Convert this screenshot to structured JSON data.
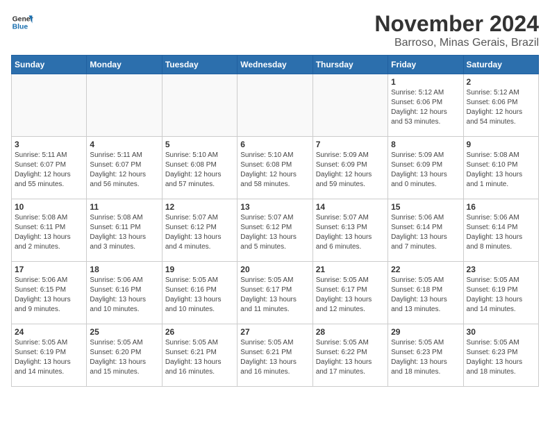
{
  "logo": {
    "general": "General",
    "blue": "Blue"
  },
  "title": "November 2024",
  "location": "Barroso, Minas Gerais, Brazil",
  "weekdays": [
    "Sunday",
    "Monday",
    "Tuesday",
    "Wednesday",
    "Thursday",
    "Friday",
    "Saturday"
  ],
  "weeks": [
    [
      {
        "day": "",
        "info": ""
      },
      {
        "day": "",
        "info": ""
      },
      {
        "day": "",
        "info": ""
      },
      {
        "day": "",
        "info": ""
      },
      {
        "day": "",
        "info": ""
      },
      {
        "day": "1",
        "info": "Sunrise: 5:12 AM\nSunset: 6:06 PM\nDaylight: 12 hours\nand 53 minutes."
      },
      {
        "day": "2",
        "info": "Sunrise: 5:12 AM\nSunset: 6:06 PM\nDaylight: 12 hours\nand 54 minutes."
      }
    ],
    [
      {
        "day": "3",
        "info": "Sunrise: 5:11 AM\nSunset: 6:07 PM\nDaylight: 12 hours\nand 55 minutes."
      },
      {
        "day": "4",
        "info": "Sunrise: 5:11 AM\nSunset: 6:07 PM\nDaylight: 12 hours\nand 56 minutes."
      },
      {
        "day": "5",
        "info": "Sunrise: 5:10 AM\nSunset: 6:08 PM\nDaylight: 12 hours\nand 57 minutes."
      },
      {
        "day": "6",
        "info": "Sunrise: 5:10 AM\nSunset: 6:08 PM\nDaylight: 12 hours\nand 58 minutes."
      },
      {
        "day": "7",
        "info": "Sunrise: 5:09 AM\nSunset: 6:09 PM\nDaylight: 12 hours\nand 59 minutes."
      },
      {
        "day": "8",
        "info": "Sunrise: 5:09 AM\nSunset: 6:09 PM\nDaylight: 13 hours\nand 0 minutes."
      },
      {
        "day": "9",
        "info": "Sunrise: 5:08 AM\nSunset: 6:10 PM\nDaylight: 13 hours\nand 1 minute."
      }
    ],
    [
      {
        "day": "10",
        "info": "Sunrise: 5:08 AM\nSunset: 6:11 PM\nDaylight: 13 hours\nand 2 minutes."
      },
      {
        "day": "11",
        "info": "Sunrise: 5:08 AM\nSunset: 6:11 PM\nDaylight: 13 hours\nand 3 minutes."
      },
      {
        "day": "12",
        "info": "Sunrise: 5:07 AM\nSunset: 6:12 PM\nDaylight: 13 hours\nand 4 minutes."
      },
      {
        "day": "13",
        "info": "Sunrise: 5:07 AM\nSunset: 6:12 PM\nDaylight: 13 hours\nand 5 minutes."
      },
      {
        "day": "14",
        "info": "Sunrise: 5:07 AM\nSunset: 6:13 PM\nDaylight: 13 hours\nand 6 minutes."
      },
      {
        "day": "15",
        "info": "Sunrise: 5:06 AM\nSunset: 6:14 PM\nDaylight: 13 hours\nand 7 minutes."
      },
      {
        "day": "16",
        "info": "Sunrise: 5:06 AM\nSunset: 6:14 PM\nDaylight: 13 hours\nand 8 minutes."
      }
    ],
    [
      {
        "day": "17",
        "info": "Sunrise: 5:06 AM\nSunset: 6:15 PM\nDaylight: 13 hours\nand 9 minutes."
      },
      {
        "day": "18",
        "info": "Sunrise: 5:06 AM\nSunset: 6:16 PM\nDaylight: 13 hours\nand 10 minutes."
      },
      {
        "day": "19",
        "info": "Sunrise: 5:05 AM\nSunset: 6:16 PM\nDaylight: 13 hours\nand 10 minutes."
      },
      {
        "day": "20",
        "info": "Sunrise: 5:05 AM\nSunset: 6:17 PM\nDaylight: 13 hours\nand 11 minutes."
      },
      {
        "day": "21",
        "info": "Sunrise: 5:05 AM\nSunset: 6:17 PM\nDaylight: 13 hours\nand 12 minutes."
      },
      {
        "day": "22",
        "info": "Sunrise: 5:05 AM\nSunset: 6:18 PM\nDaylight: 13 hours\nand 13 minutes."
      },
      {
        "day": "23",
        "info": "Sunrise: 5:05 AM\nSunset: 6:19 PM\nDaylight: 13 hours\nand 14 minutes."
      }
    ],
    [
      {
        "day": "24",
        "info": "Sunrise: 5:05 AM\nSunset: 6:19 PM\nDaylight: 13 hours\nand 14 minutes."
      },
      {
        "day": "25",
        "info": "Sunrise: 5:05 AM\nSunset: 6:20 PM\nDaylight: 13 hours\nand 15 minutes."
      },
      {
        "day": "26",
        "info": "Sunrise: 5:05 AM\nSunset: 6:21 PM\nDaylight: 13 hours\nand 16 minutes."
      },
      {
        "day": "27",
        "info": "Sunrise: 5:05 AM\nSunset: 6:21 PM\nDaylight: 13 hours\nand 16 minutes."
      },
      {
        "day": "28",
        "info": "Sunrise: 5:05 AM\nSunset: 6:22 PM\nDaylight: 13 hours\nand 17 minutes."
      },
      {
        "day": "29",
        "info": "Sunrise: 5:05 AM\nSunset: 6:23 PM\nDaylight: 13 hours\nand 18 minutes."
      },
      {
        "day": "30",
        "info": "Sunrise: 5:05 AM\nSunset: 6:23 PM\nDaylight: 13 hours\nand 18 minutes."
      }
    ]
  ]
}
